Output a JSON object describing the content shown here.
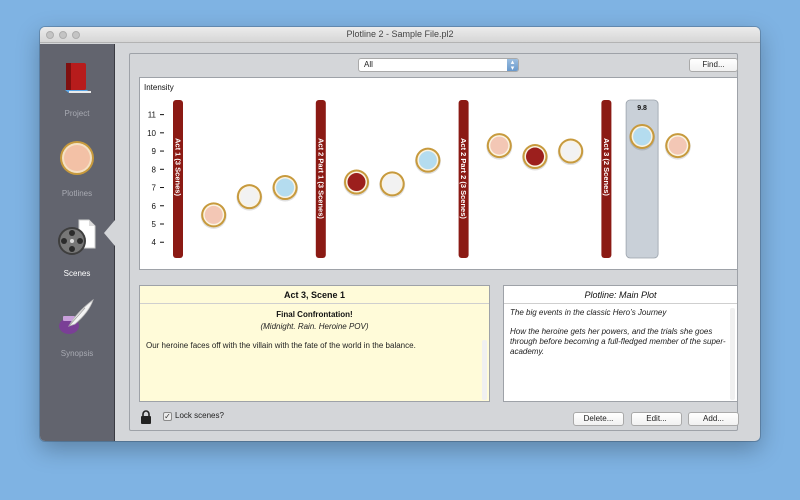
{
  "window": {
    "title": "Plotline 2 - Sample File.pl2"
  },
  "sidebar": {
    "items": [
      {
        "label": "Project",
        "icon": "book-icon",
        "active": false
      },
      {
        "label": "Plotlines",
        "icon": "plotline-circle-icon",
        "active": false
      },
      {
        "label": "Scenes",
        "icon": "film-reel-icon",
        "active": true
      },
      {
        "label": "Synopsis",
        "icon": "quill-icon",
        "active": false
      }
    ]
  },
  "toolbar": {
    "filter_value": "All",
    "find_label": "Find..."
  },
  "chart_data": {
    "type": "scatter",
    "ylabel": "Intensity",
    "yticks": [
      4,
      5,
      6,
      7,
      8,
      9,
      10,
      11
    ],
    "ylim": [
      3.3,
      11.8
    ],
    "acts": [
      {
        "label": "Act 1  (3 Scenes)",
        "slot": 0
      },
      {
        "label": "Act 2 Part 1  (3 Scenes)",
        "slot": 4
      },
      {
        "label": "Act 2 Part 2  (3 Scenes)",
        "slot": 8
      },
      {
        "label": "Act 3  (2 Scenes)",
        "slot": 12
      }
    ],
    "scenes": [
      {
        "slot": 1,
        "value": 5.5,
        "color": "#f3c7b5"
      },
      {
        "slot": 2,
        "value": 6.5,
        "color": "#f2f2f2"
      },
      {
        "slot": 3,
        "value": 7.0,
        "color": "#b4dcef"
      },
      {
        "slot": 5,
        "value": 7.3,
        "color": "#9c1f1d"
      },
      {
        "slot": 6,
        "value": 7.2,
        "color": "#f2f2f2"
      },
      {
        "slot": 7,
        "value": 8.5,
        "color": "#b4dcef"
      },
      {
        "slot": 9,
        "value": 9.3,
        "color": "#f3c7b5"
      },
      {
        "slot": 10,
        "value": 8.7,
        "color": "#9c1f1d"
      },
      {
        "slot": 11,
        "value": 9.0,
        "color": "#f2f2f2"
      },
      {
        "slot": 13,
        "value": 9.8,
        "color": "#b4dcef",
        "selected": true,
        "label": "9.8"
      },
      {
        "slot": 14,
        "value": 9.3,
        "color": "#f3c7b5"
      }
    ],
    "colors": {
      "act_bar": "#8b1a14",
      "selection": "#c9d0d8",
      "ring": "#c79a3d"
    }
  },
  "scene": {
    "header": "Act 3, Scene 1",
    "title": "Final Confrontation!",
    "subtitle": "(Midnight. Rain. Heroine POV)",
    "body": "Our heroine faces off with the villain with the fate of the world in the balance."
  },
  "plotline": {
    "header": "Plotline: Main Plot",
    "para1": "The big events in the classic Hero’s Journey",
    "para2": "How the heroine gets her powers, and the trials she goes through before becoming a full-fledged member of the super-academy."
  },
  "footer": {
    "lock_label": "Lock scenes?",
    "lock_checked": true,
    "delete_label": "Delete...",
    "edit_label": "Edit...",
    "add_label": "Add..."
  }
}
